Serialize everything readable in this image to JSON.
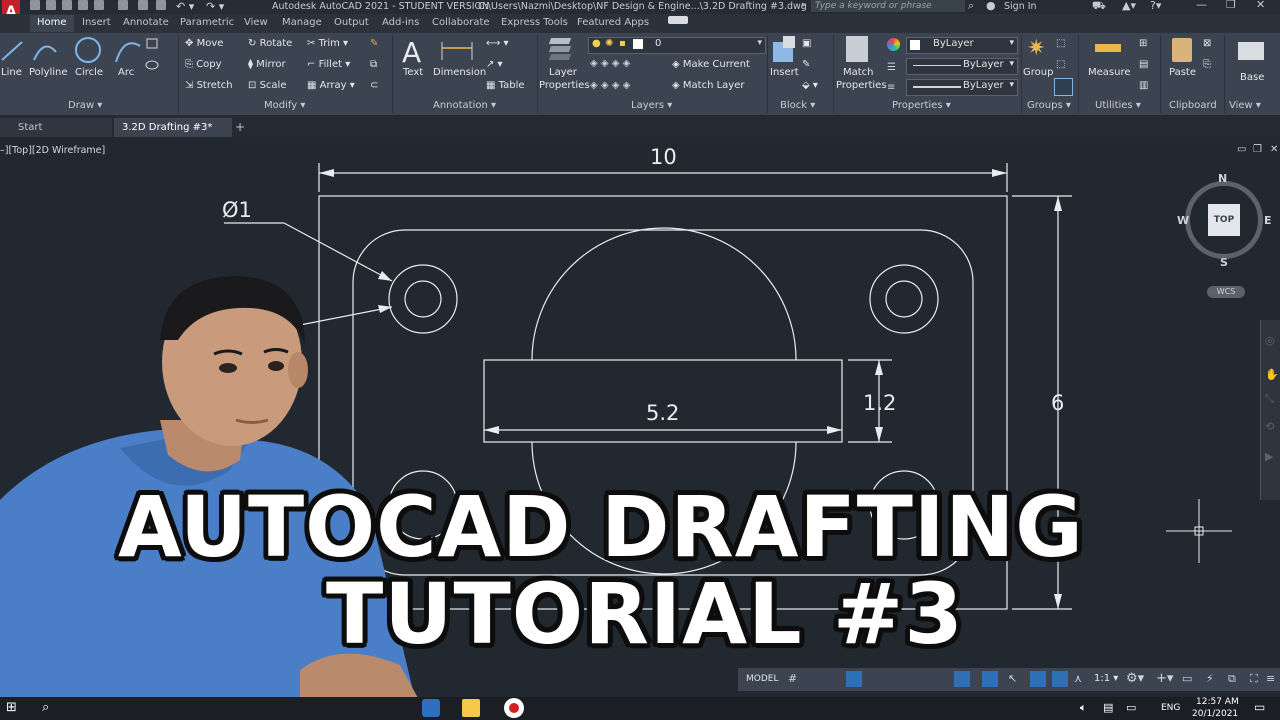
{
  "titlebar": {
    "app_title": "Autodesk AutoCAD 2021 - STUDENT VERSION",
    "file_path": "C:\\Users\\Nazmi\\Desktop\\NF Design & Engine...\\3.2D Drafting #3.dwg",
    "search_placeholder": "Type a keyword or phrase",
    "sign_in": "Sign In",
    "logo": "A"
  },
  "tabs": [
    "Home",
    "Insert",
    "Annotate",
    "Parametric",
    "View",
    "Manage",
    "Output",
    "Add-ins",
    "Collaborate",
    "Express Tools",
    "Featured Apps"
  ],
  "ribbon": {
    "draw": {
      "line": "Line",
      "polyline": "Polyline",
      "circle": "Circle",
      "arc": "Arc",
      "panel": "Draw ▾"
    },
    "modify": {
      "move": "Move",
      "rotate": "Rotate",
      "trim": "Trim ▾",
      "copy": "Copy",
      "mirror": "Mirror",
      "fillet": "Fillet ▾",
      "stretch": "Stretch",
      "scale": "Scale",
      "array": "Array ▾",
      "panel": "Modify ▾"
    },
    "annotation": {
      "text": "Text",
      "dimension": "Dimension",
      "table": "Table",
      "panel": "Annotation ▾"
    },
    "layers": {
      "layer_properties_1": "Layer",
      "layer_properties_2": "Properties",
      "current_layer": "0",
      "make_current": "Make Current",
      "match_layer": "Match Layer",
      "panel": "Layers ▾"
    },
    "block": {
      "insert": "Insert",
      "panel": "Block ▾"
    },
    "properties": {
      "match_1": "Match",
      "match_2": "Properties",
      "color": "ByLayer",
      "linetype": "ByLayer",
      "lineweight": "ByLayer",
      "panel": "Properties ▾"
    },
    "groups": {
      "group": "Group",
      "panel": "Groups ▾"
    },
    "utilities": {
      "measure": "Measure",
      "panel": "Utilities ▾"
    },
    "clipboard": {
      "paste": "Paste",
      "panel": "Clipboard"
    },
    "view": {
      "base": "Base",
      "panel": "View ▾"
    }
  },
  "doc_tabs": {
    "start": "Start",
    "active": "3.2D Drafting #3*",
    "add": "+"
  },
  "viewport_label": "–][Top][2D Wireframe]",
  "drawing": {
    "dim_width": "10",
    "dim_height": "6",
    "dim_slot_width": "5.2",
    "dim_slot_height": "1.2",
    "dim_hole": "Ø1"
  },
  "viewcube": {
    "n": "N",
    "s": "S",
    "e": "E",
    "w": "W",
    "top": "TOP",
    "wcs": "WCS"
  },
  "statusbar": {
    "model": "MODEL",
    "scale": "1:1 ▾"
  },
  "taskbar": {
    "lang": "ENG",
    "time": "12:57 AM",
    "date": "20/1/2021"
  },
  "overlay": {
    "line1": "AUTOCAD DRAFTING",
    "line2": "TUTORIAL #3"
  },
  "colors": {
    "background": "#212830",
    "ribbon": "#3b4450",
    "drawing_line": "#e8ecef",
    "autocad_red": "#c51f27",
    "shirt_blue": "#4a7fc7"
  }
}
